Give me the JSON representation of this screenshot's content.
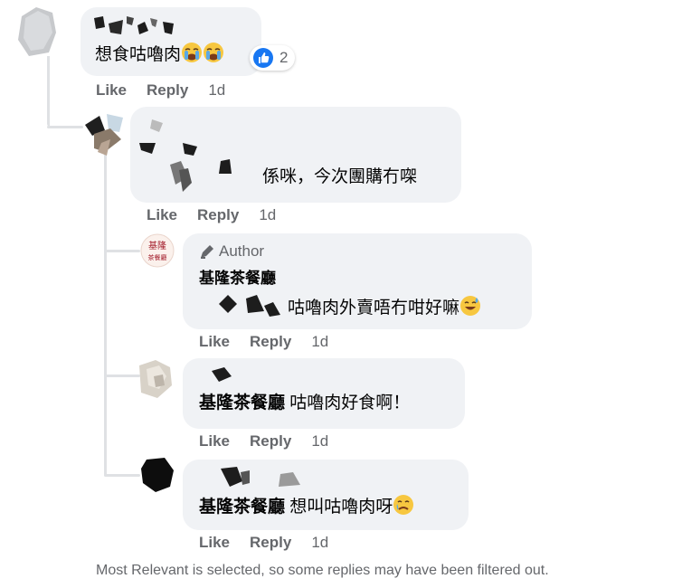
{
  "colors": {
    "bubble": "#f0f2f5",
    "meta_text": "#65676b",
    "like_blue": "#1877f2",
    "thread_line": "#dfe1e4"
  },
  "actions": {
    "like": "Like",
    "reply": "Reply"
  },
  "comments": [
    {
      "text": "想食咕嚕肉",
      "emojis": [
        "crying-face",
        "crying-face"
      ],
      "reaction_icon": "thumbs-up-icon",
      "reaction_count": "2",
      "time": "1d"
    },
    {
      "text": "係咪，今次團購冇㗎",
      "time": "1d"
    },
    {
      "author_badge": "Author",
      "page_name": "基隆茶餐廳",
      "text": "咕嚕肉外賣唔冇咁好嘛",
      "emoji": "sweat-smile",
      "time": "1d"
    },
    {
      "mention": "基隆茶餐廳",
      "text": "咕嚕肉好食啊！",
      "time": "1d"
    },
    {
      "mention": "基隆茶餐廳",
      "text": "想叫咕嚕肉呀",
      "emoji": "crying-face",
      "time": "1d"
    }
  ],
  "footer_note": "Most Relevant is selected, so some replies may have been filtered out."
}
